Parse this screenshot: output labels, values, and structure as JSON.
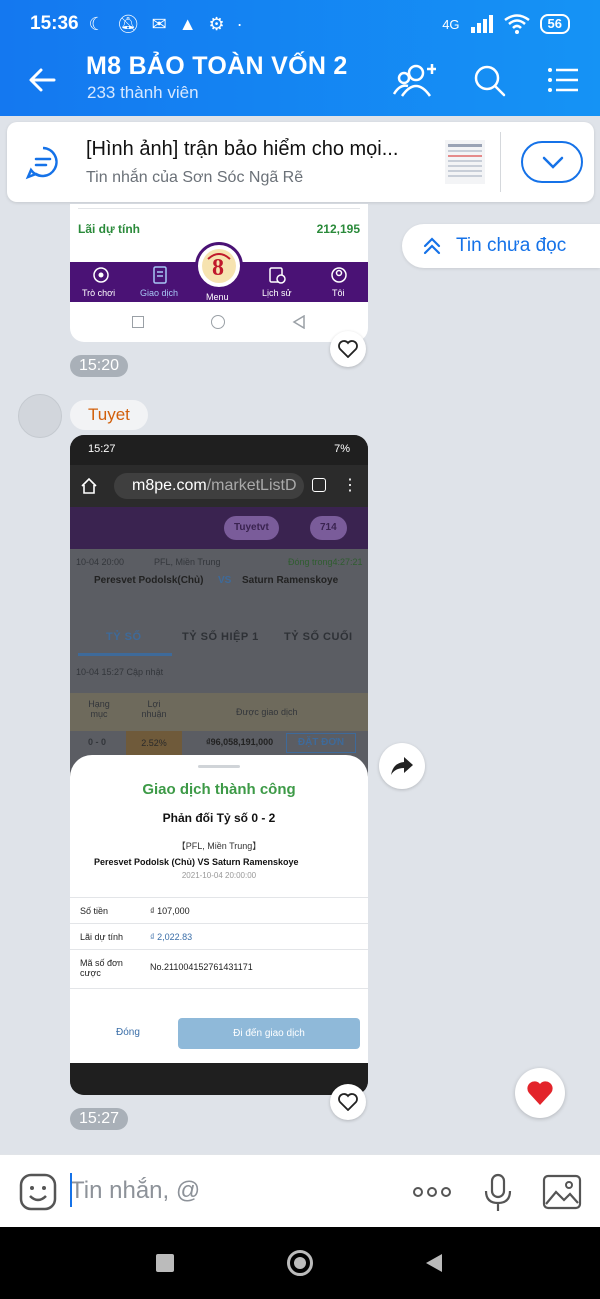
{
  "status_bar": {
    "time": "15:36",
    "network": "4G",
    "battery": "56"
  },
  "header": {
    "title": "M8 BẢO TOÀN VỐN 2",
    "subtitle": "233 thành viên"
  },
  "pinned": {
    "title": "[Hình ảnh] trận bảo hiểm cho mọi...",
    "subtitle": "Tin nhắn của Sơn Sóc  Ngã Rẽ"
  },
  "unread_button": "Tin chưa đọc",
  "message1": {
    "row_label": "Lãi dự tính",
    "row_value": "212,195",
    "nav": [
      "Trò chơi",
      "Giao dịch",
      "Menu",
      "Lịch sử",
      "Tôi"
    ],
    "time": "15:20"
  },
  "sender": "Tuyet",
  "message2": {
    "phone_time": "15:27",
    "phone_battery": "7%",
    "url_prefix": "m8pe.com",
    "url_path": "/marketListD",
    "user_chip": "Tuyetvt",
    "balance_chip": "714",
    "match_time": "10-04 20:00",
    "league": "PFL, Miền Trung",
    "countdown": "Đóng trong4:27:21",
    "home": "Peresvet Podolsk(Chủ)",
    "vs": "VS",
    "away": "Saturn Ramenskoye",
    "tabs": [
      "TỶ SỐ",
      "TỶ SỐ HIỆP 1",
      "TỶ SỐ CUỐI"
    ],
    "updated": "10-04 15:27 Cập nhật",
    "table_headers": [
      "Hạng mục",
      "Lợi nhuận",
      "Được giao dịch"
    ],
    "row": {
      "score": "0 - 0",
      "profit": "2.52%",
      "amount": "₫96,058,191,000",
      "action": "ĐẶT ĐƠN"
    },
    "sheet": {
      "title": "Giao dịch thành công",
      "subtitle": "Phản đối Tỷ số 0 - 2",
      "league": "【PFL, Miền Trung】",
      "teams": "Peresvet Podolsk (Chủ)    VS    Saturn Ramenskoye",
      "date": "2021-10-04 20:00:00",
      "rows": [
        {
          "label": "Số tiền",
          "value": "₫ 107,000"
        },
        {
          "label": "Lãi dự tính",
          "value": "₫ 2,022.83"
        },
        {
          "label": "Mã số đơn cược",
          "value": "No.211004152761431171"
        }
      ],
      "close": "Đóng",
      "go": "Đi đến giao dịch"
    },
    "time": "15:27"
  },
  "composer": {
    "placeholder": "Tin nhắn, @"
  },
  "colors": {
    "header_blue": "#1478f0",
    "accent_blue": "#1572e8",
    "chat_bg": "#dfe3e9",
    "sender_orange": "#d2600c",
    "heart_red": "#e3242b"
  }
}
